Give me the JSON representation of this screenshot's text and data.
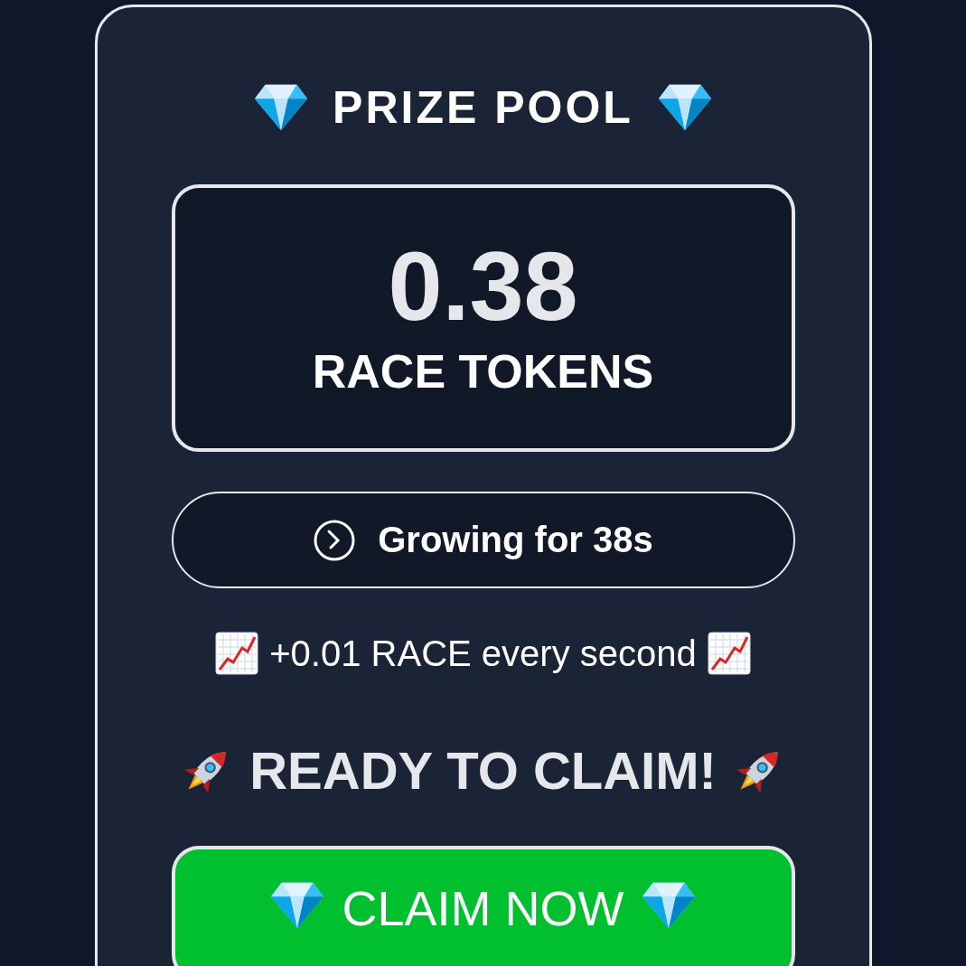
{
  "title": "PRIZE POOL",
  "prize": {
    "amount": "0.38",
    "unit": "RACE TOKENS"
  },
  "timer": "Growing for 38s",
  "rate": "+0.01 RACE every second",
  "status": "READY TO CLAIM!",
  "claim_button": "CLAIM NOW"
}
